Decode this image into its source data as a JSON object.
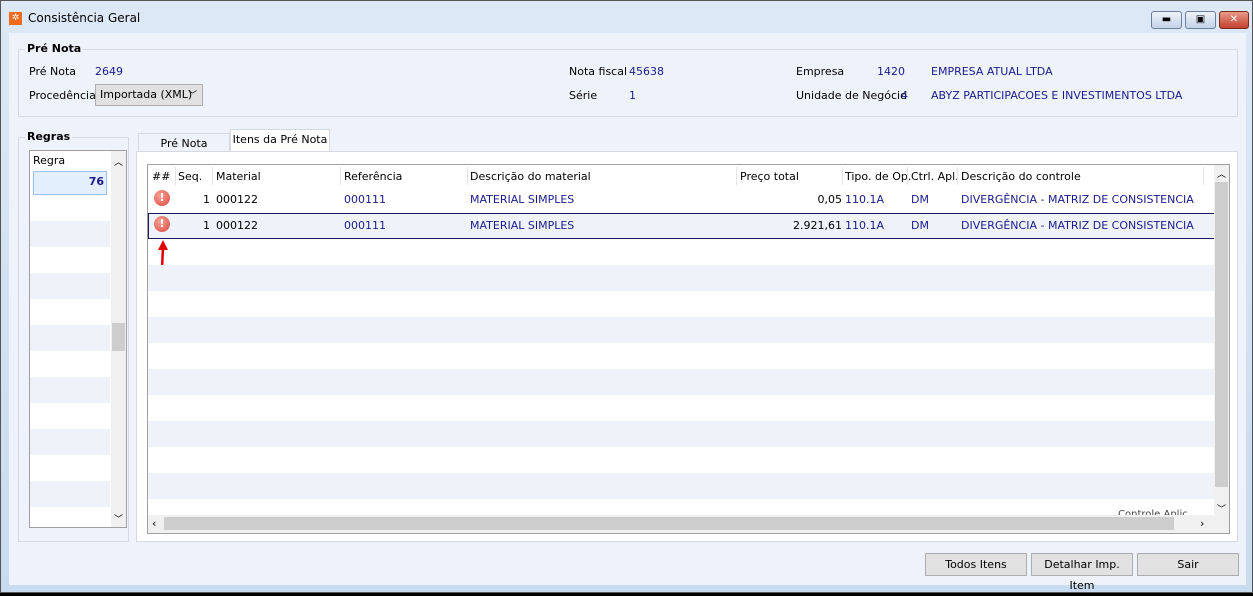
{
  "window": {
    "title": "Consistência Geral",
    "controls": [
      "minimize",
      "maximize",
      "close"
    ]
  },
  "pre_nota_group": {
    "title": "Pré Nota",
    "pre_nota_label": "Pré Nota",
    "pre_nota_value": "2649",
    "procedencia_label": "Procedência",
    "procedencia_value": "Importada (XML)",
    "nota_fiscal_label": "Nota fiscal",
    "nota_fiscal_value": "45638",
    "serie_label": "Série",
    "serie_value": "1",
    "empresa_label": "Empresa",
    "empresa_code": "1420",
    "empresa_name": "EMPRESA ATUAL LTDA",
    "unidade_label": "Unidade de Negócio",
    "unidade_code": "4",
    "unidade_name": "ABYZ PARTICIPACOES E INVESTIMENTOS LTDA"
  },
  "regras": {
    "title": "Regras",
    "column": "Regra",
    "rows": [
      "76"
    ]
  },
  "tabs": [
    {
      "label": "Pré Nota",
      "active": false
    },
    {
      "label": "Itens da Pré Nota",
      "active": true
    }
  ],
  "grid": {
    "columns": [
      "##",
      "Seq.",
      "Material",
      "Referência",
      "Descrição do material",
      "Preço total",
      "Tipo. de Op.",
      "Ctrl. Apl.",
      "Descrição do controle"
    ],
    "rows": [
      {
        "icon": "error-icon",
        "seq": "1",
        "material": "000122",
        "referencia": "000111",
        "descricao": "MATERIAL SIMPLES",
        "preco": "0,05",
        "tipo_op": "110.1A",
        "ctrl": "DM",
        "desc_controle": "DIVERGÊNCIA - MATRIZ DE CONSISTENCIA"
      },
      {
        "icon": "error-icon",
        "seq": "1",
        "material": "000122",
        "referencia": "000111",
        "descricao": "MATERIAL SIMPLES",
        "preco": "2.921,61",
        "tipo_op": "110.1A",
        "ctrl": "DM",
        "desc_controle": "DIVERGÊNCIA - MATRIZ DE CONSISTENCIA"
      }
    ],
    "footer_clipped": "Controle Aplic"
  },
  "buttons": {
    "todos_itens": "Todos Itens",
    "detalhar": "Detalhar Imp. Item",
    "sair": "Sair"
  },
  "colors": {
    "value_text": "#1a1a8c",
    "selected_border": "#1a1a5a",
    "annotation_arrow": "#e00000"
  }
}
